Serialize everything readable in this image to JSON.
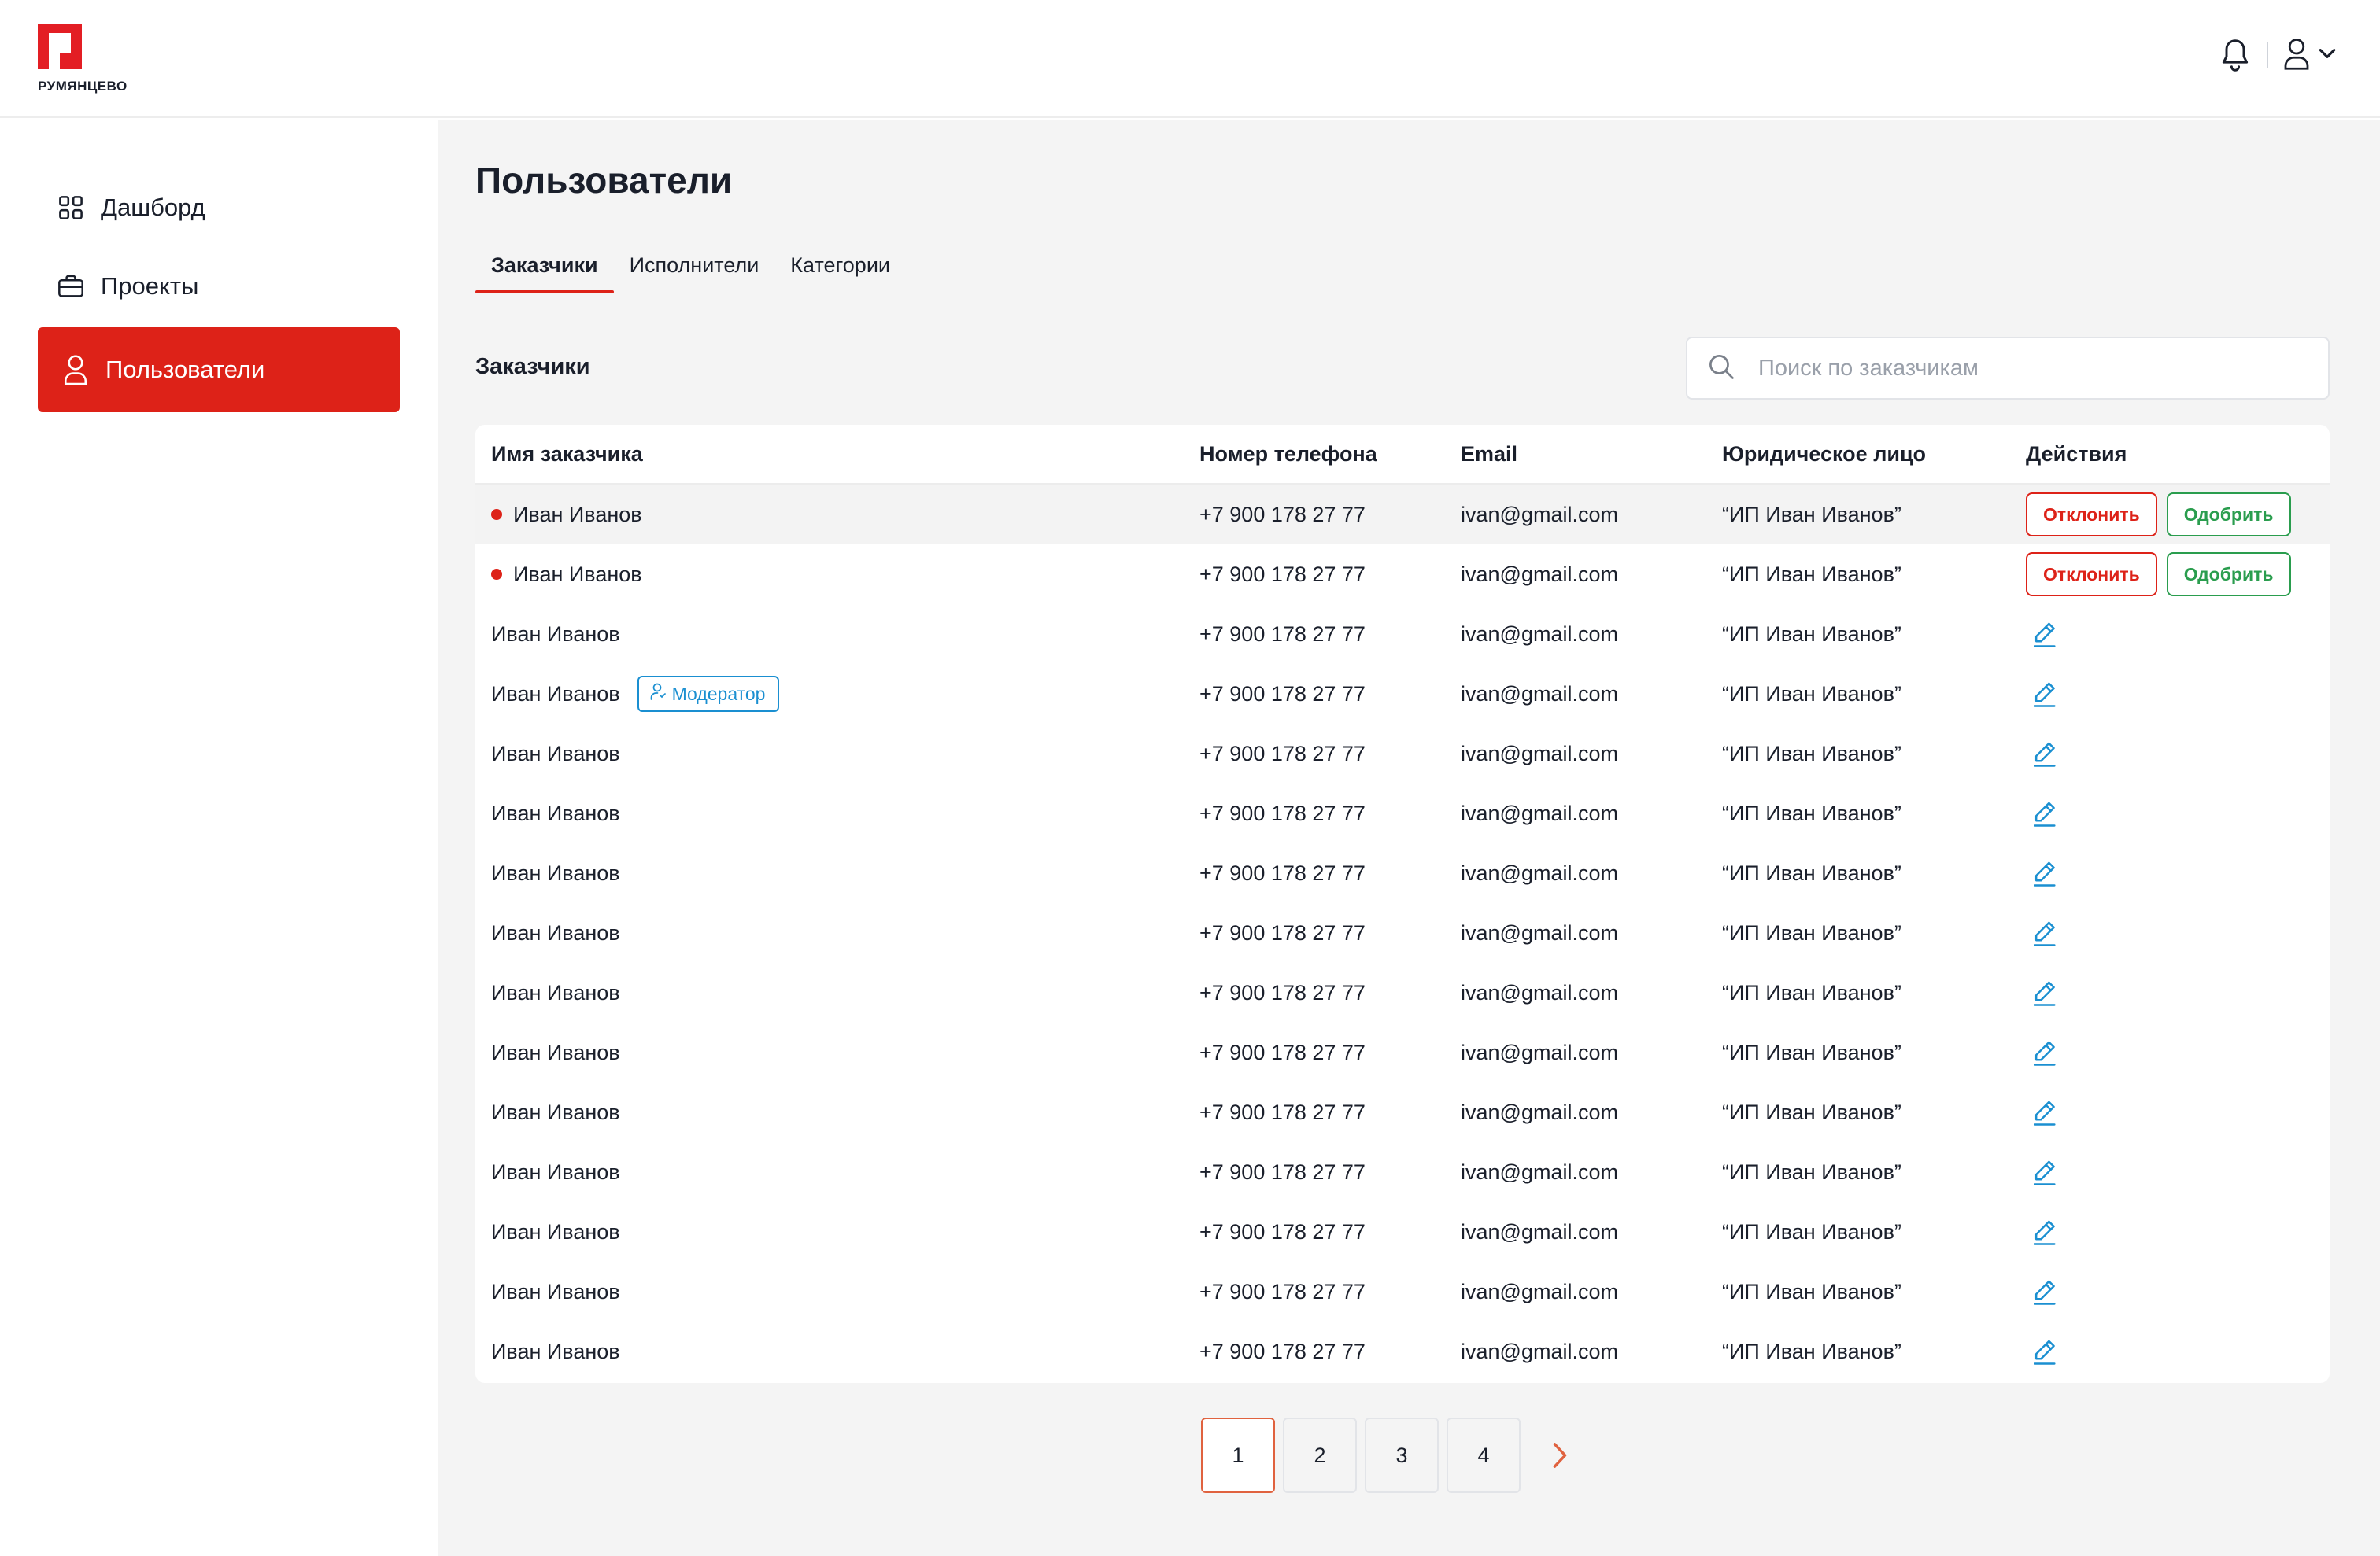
{
  "brand": {
    "name": "РУМЯНЦЕВО",
    "accent": "#dd2218"
  },
  "header": {
    "notifications_icon": "bell-icon",
    "profile_icon": "user-icon",
    "dropdown_icon": "chevron-down-icon"
  },
  "sidebar": {
    "items": [
      {
        "label": "Дашборд",
        "icon": "dashboard-grid-icon",
        "active": false
      },
      {
        "label": "Проекты",
        "icon": "briefcase-icon",
        "active": false
      },
      {
        "label": "Пользователи",
        "icon": "user-icon",
        "active": true
      }
    ]
  },
  "main": {
    "title": "Пользователи",
    "tabs": [
      {
        "label": "Заказчики",
        "active": true
      },
      {
        "label": "Исполнители",
        "active": false
      },
      {
        "label": "Категории",
        "active": false
      }
    ],
    "section_title": "Заказчики",
    "search": {
      "placeholder": "Поиск по заказчикам",
      "value": ""
    }
  },
  "table": {
    "columns": [
      "Имя заказчика",
      "Номер телефона",
      "Email",
      "Юридическое лицо",
      "Действия"
    ],
    "reject_label": "Отклонить",
    "approve_label": "Одобрить",
    "moderator_badge": "Модератор",
    "rows": [
      {
        "name": "Иван Иванов",
        "phone": "+7 900 178 27 77",
        "email": "ivan@gmail.com",
        "legal": "“ИП Иван Иванов”",
        "pending": true,
        "moderator": false
      },
      {
        "name": "Иван Иванов",
        "phone": "+7 900 178 27 77",
        "email": "ivan@gmail.com",
        "legal": "“ИП Иван Иванов”",
        "pending": true,
        "moderator": false
      },
      {
        "name": "Иван Иванов",
        "phone": "+7 900 178 27 77",
        "email": "ivan@gmail.com",
        "legal": "“ИП Иван Иванов”",
        "pending": false,
        "moderator": false
      },
      {
        "name": "Иван Иванов",
        "phone": "+7 900 178 27 77",
        "email": "ivan@gmail.com",
        "legal": "“ИП Иван Иванов”",
        "pending": false,
        "moderator": true
      },
      {
        "name": "Иван Иванов",
        "phone": "+7 900 178 27 77",
        "email": "ivan@gmail.com",
        "legal": "“ИП Иван Иванов”",
        "pending": false,
        "moderator": false
      },
      {
        "name": "Иван Иванов",
        "phone": "+7 900 178 27 77",
        "email": "ivan@gmail.com",
        "legal": "“ИП Иван Иванов”",
        "pending": false,
        "moderator": false
      },
      {
        "name": "Иван Иванов",
        "phone": "+7 900 178 27 77",
        "email": "ivan@gmail.com",
        "legal": "“ИП Иван Иванов”",
        "pending": false,
        "moderator": false
      },
      {
        "name": "Иван Иванов",
        "phone": "+7 900 178 27 77",
        "email": "ivan@gmail.com",
        "legal": "“ИП Иван Иванов”",
        "pending": false,
        "moderator": false
      },
      {
        "name": "Иван Иванов",
        "phone": "+7 900 178 27 77",
        "email": "ivan@gmail.com",
        "legal": "“ИП Иван Иванов”",
        "pending": false,
        "moderator": false
      },
      {
        "name": "Иван Иванов",
        "phone": "+7 900 178 27 77",
        "email": "ivan@gmail.com",
        "legal": "“ИП Иван Иванов”",
        "pending": false,
        "moderator": false
      },
      {
        "name": "Иван Иванов",
        "phone": "+7 900 178 27 77",
        "email": "ivan@gmail.com",
        "legal": "“ИП Иван Иванов”",
        "pending": false,
        "moderator": false
      },
      {
        "name": "Иван Иванов",
        "phone": "+7 900 178 27 77",
        "email": "ivan@gmail.com",
        "legal": "“ИП Иван Иванов”",
        "pending": false,
        "moderator": false
      },
      {
        "name": "Иван Иванов",
        "phone": "+7 900 178 27 77",
        "email": "ivan@gmail.com",
        "legal": "“ИП Иван Иванов”",
        "pending": false,
        "moderator": false
      },
      {
        "name": "Иван Иванов",
        "phone": "+7 900 178 27 77",
        "email": "ivan@gmail.com",
        "legal": "“ИП Иван Иванов”",
        "pending": false,
        "moderator": false
      },
      {
        "name": "Иван Иванов",
        "phone": "+7 900 178 27 77",
        "email": "ivan@gmail.com",
        "legal": "“ИП Иван Иванов”",
        "pending": false,
        "moderator": false
      }
    ]
  },
  "pagination": {
    "pages": [
      "1",
      "2",
      "3",
      "4"
    ],
    "current": "1",
    "next_icon": "chevron-right-icon"
  }
}
